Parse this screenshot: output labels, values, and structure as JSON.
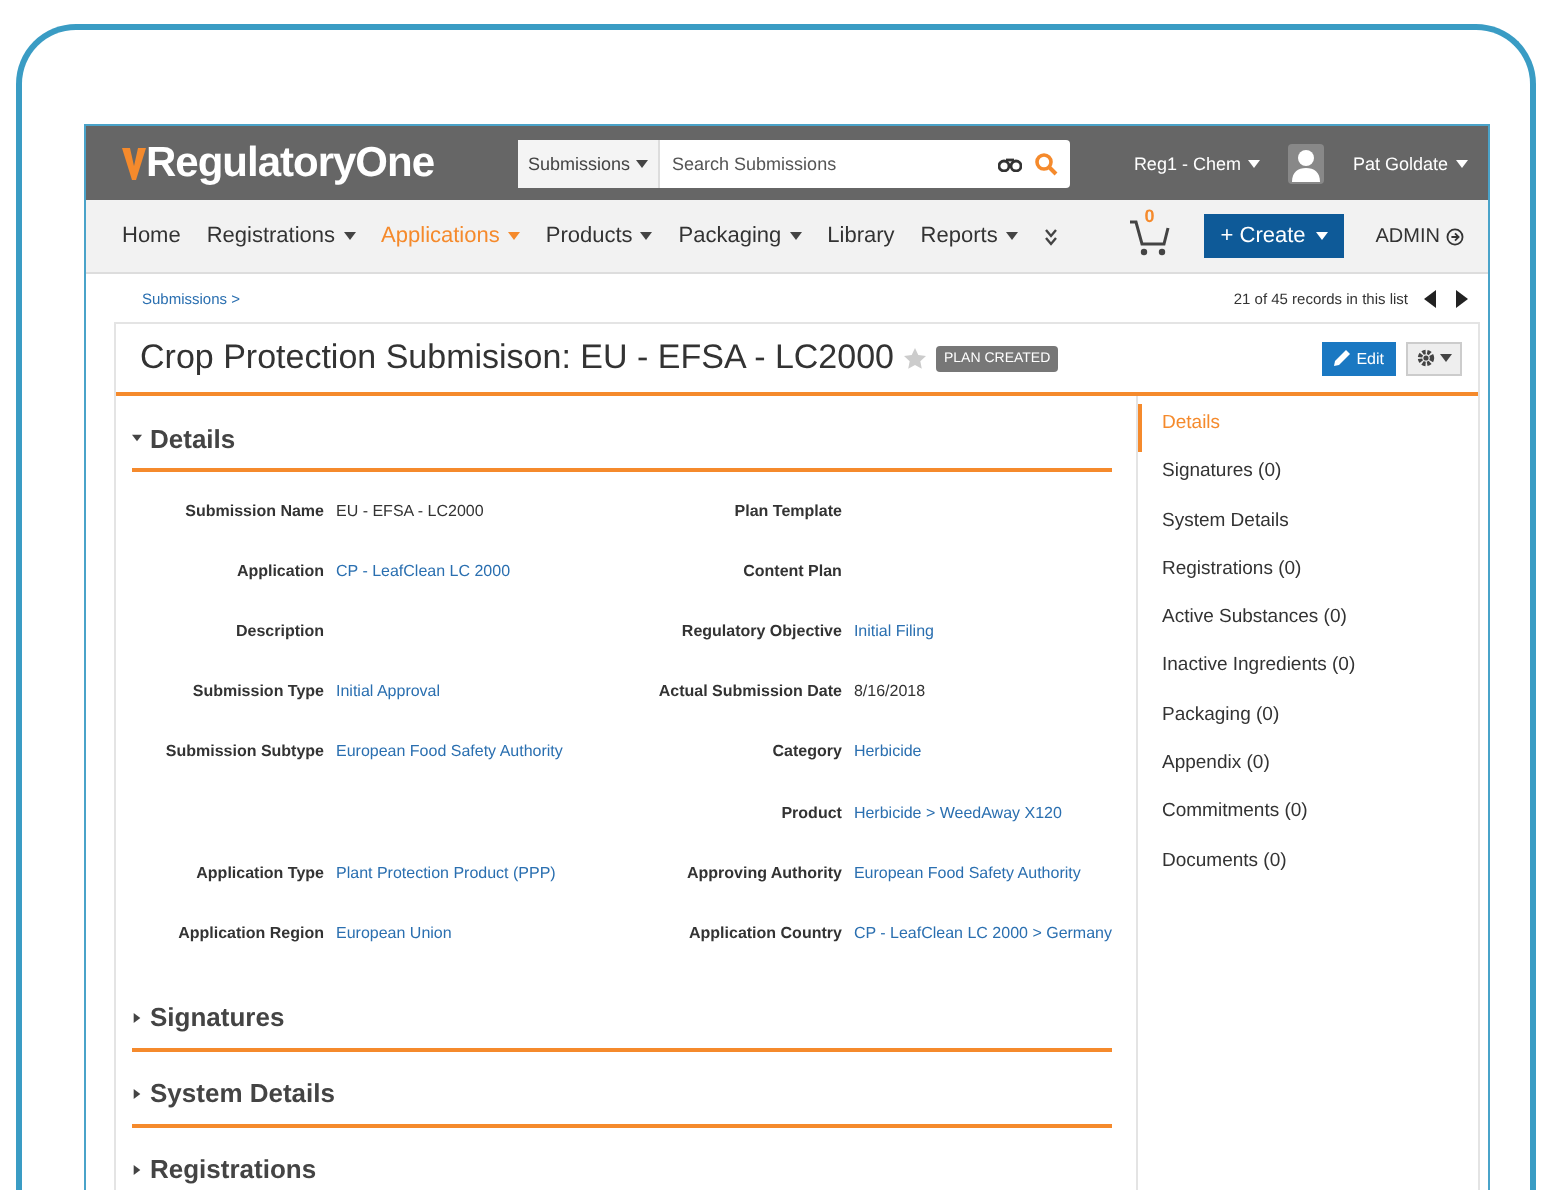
{
  "header": {
    "logo": "RegulatoryOne",
    "search": {
      "scope": "Submissions",
      "placeholder": "Search Submissions"
    },
    "vault": "Reg1 - Chem",
    "user": "Pat Goldate"
  },
  "nav": {
    "items": [
      {
        "label": "Home",
        "dropdown": false,
        "selected": false
      },
      {
        "label": "Registrations",
        "dropdown": true,
        "selected": false
      },
      {
        "label": "Applications",
        "dropdown": true,
        "selected": true
      },
      {
        "label": "Products",
        "dropdown": true,
        "selected": false
      },
      {
        "label": "Packaging",
        "dropdown": true,
        "selected": false
      },
      {
        "label": "Library",
        "dropdown": false,
        "selected": false
      },
      {
        "label": "Reports",
        "dropdown": true,
        "selected": false
      }
    ],
    "cart_count": "0",
    "create": "+ Create",
    "admin": "ADMIN"
  },
  "breadcrumb": "Submissions >",
  "record_count": "21 of 45 records in this list",
  "record": {
    "title": "Crop Protection Submisison: EU - EFSA - LC2000",
    "status": "PLAN CREATED",
    "edit": "Edit"
  },
  "sections": [
    {
      "title": "Details",
      "expanded": true
    },
    {
      "title": "Signatures",
      "expanded": false
    },
    {
      "title": "System Details",
      "expanded": false
    },
    {
      "title": "Registrations",
      "expanded": false
    }
  ],
  "fields": [
    {
      "left": {
        "label": "Submission Name",
        "value": "EU - EFSA - LC2000",
        "link": false
      },
      "right": {
        "label": "Plan Template"
      }
    },
    {
      "left": {
        "label": "Application",
        "value": "CP - LeafClean LC 2000",
        "link": true
      },
      "right": {
        "label": "Content Plan"
      }
    },
    {
      "left": {
        "label": "Description"
      },
      "right": {
        "label": "Regulatory Objective",
        "value": "Initial Filing",
        "link": true
      }
    },
    {
      "left": {
        "label": "Submission Type",
        "value": "Initial Approval",
        "link": true
      },
      "right": {
        "label": "Actual Submission Date",
        "value": "8/16/2018",
        "link": false
      }
    },
    {
      "left": {
        "label": "Submission Subtype",
        "value": "European Food Safety Authority",
        "link": true
      },
      "right": {
        "label": "Category",
        "value": "Herbicide",
        "link": true
      }
    },
    {
      "right": {
        "label": "Product",
        "value": "Herbicide > WeedAway X120",
        "link": true
      }
    },
    {
      "left": {
        "label": "Application Type",
        "value": "Plant Protection Product (PPP)",
        "link": true
      },
      "right": {
        "label": "Approving Authority",
        "value": "European Food Safety Authority",
        "link": true
      }
    },
    {
      "left": {
        "label": "Application Region",
        "value": "European Union",
        "link": true
      },
      "right": {
        "label": "Application Country",
        "value": "CP - LeafClean LC 2000 > Germany",
        "link": true
      }
    }
  ],
  "sidebar": [
    {
      "label": "Details",
      "selected": true
    },
    {
      "label": "Signatures (0)",
      "selected": false
    },
    {
      "label": "System Details",
      "selected": false
    },
    {
      "label": "Registrations (0)",
      "selected": false
    },
    {
      "label": "Active Substances (0)",
      "selected": false
    },
    {
      "label": "Inactive Ingredients (0)",
      "selected": false
    },
    {
      "label": "Packaging (0)",
      "selected": false
    },
    {
      "label": "Appendix (0)",
      "selected": false
    },
    {
      "label": "Commitments (0)",
      "selected": false
    },
    {
      "label": "Documents (0)",
      "selected": false
    }
  ]
}
